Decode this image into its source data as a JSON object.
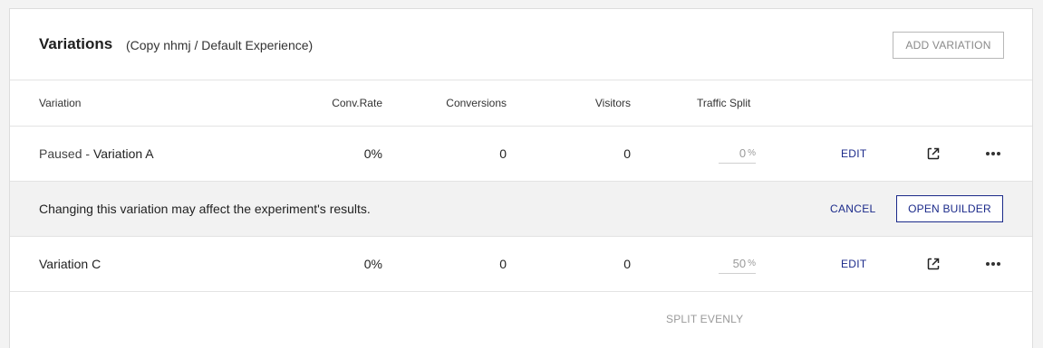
{
  "header": {
    "title": "Variations",
    "subtitle": "(Copy nhmj / Default Experience)",
    "add_variation_label": "ADD VARIATION"
  },
  "columns": {
    "variation": "Variation",
    "conv_rate": "Conv.Rate",
    "conversions": "Conversions",
    "visitors": "Visitors",
    "traffic_split": "Traffic Split"
  },
  "rows": [
    {
      "status_prefix": "Paused - ",
      "name": "Variation A",
      "conv_rate": "0%",
      "conversions": "0",
      "visitors": "0",
      "split": "0",
      "split_unit": "%",
      "edit_label": "EDIT",
      "open_icon": "external-link-icon",
      "more_icon": "more-dots-icon"
    },
    {
      "status_prefix": "",
      "name": "Variation C",
      "conv_rate": "0%",
      "conversions": "0",
      "visitors": "0",
      "split": "50",
      "split_unit": "%",
      "edit_label": "EDIT",
      "open_icon": "external-link-icon",
      "more_icon": "more-dots-icon"
    }
  ],
  "warning": {
    "message": "Changing this variation may affect the experiment's results.",
    "cancel_label": "CANCEL",
    "open_builder_label": "OPEN BUILDER"
  },
  "footer": {
    "split_evenly_label": "SPLIT EVENLY"
  },
  "colors": {
    "accent": "#1b2a8a",
    "warning_bg": "#f2f2f2",
    "muted": "#9a9a9a"
  }
}
